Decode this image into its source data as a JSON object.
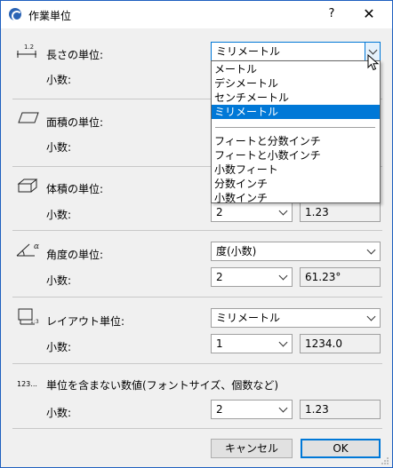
{
  "window": {
    "title": "作業単位",
    "help": "?",
    "close": "✕"
  },
  "length": {
    "icon_label": "1.2",
    "label": "長さの単位:",
    "decimal_label": "小数:",
    "unit_value": "ミリメートル",
    "options": [
      "メートル",
      "デシメートル",
      "センチメートル",
      "ミリメートル",
      "フィートと分数インチ",
      "フィートと小数インチ",
      "小数フィート",
      "分数インチ",
      "小数インチ"
    ],
    "selected_option": "ミリメートル"
  },
  "area": {
    "label": "面積の単位:",
    "decimal_label": "小数:"
  },
  "volume": {
    "label": "体積の単位:",
    "decimal_label": "小数:",
    "decimal_value": "2",
    "preview": "1.23"
  },
  "angle": {
    "icon_label": "α",
    "label": "角度の単位:",
    "unit_value": "度(小数)",
    "decimal_label": "小数:",
    "decimal_value": "2",
    "preview": "61.23°"
  },
  "layout": {
    "label": "レイアウト単位:",
    "unit_value": "ミリメートル",
    "decimal_label": "小数:",
    "decimal_value": "1",
    "preview": "1234.0"
  },
  "unitless": {
    "icon_label": "123...",
    "label": "単位を含まない数値(フォントサイズ、個数など)",
    "decimal_label": "小数:",
    "decimal_value": "2",
    "preview": "1.23"
  },
  "buttons": {
    "cancel": "キャンセル",
    "ok": "OK"
  }
}
